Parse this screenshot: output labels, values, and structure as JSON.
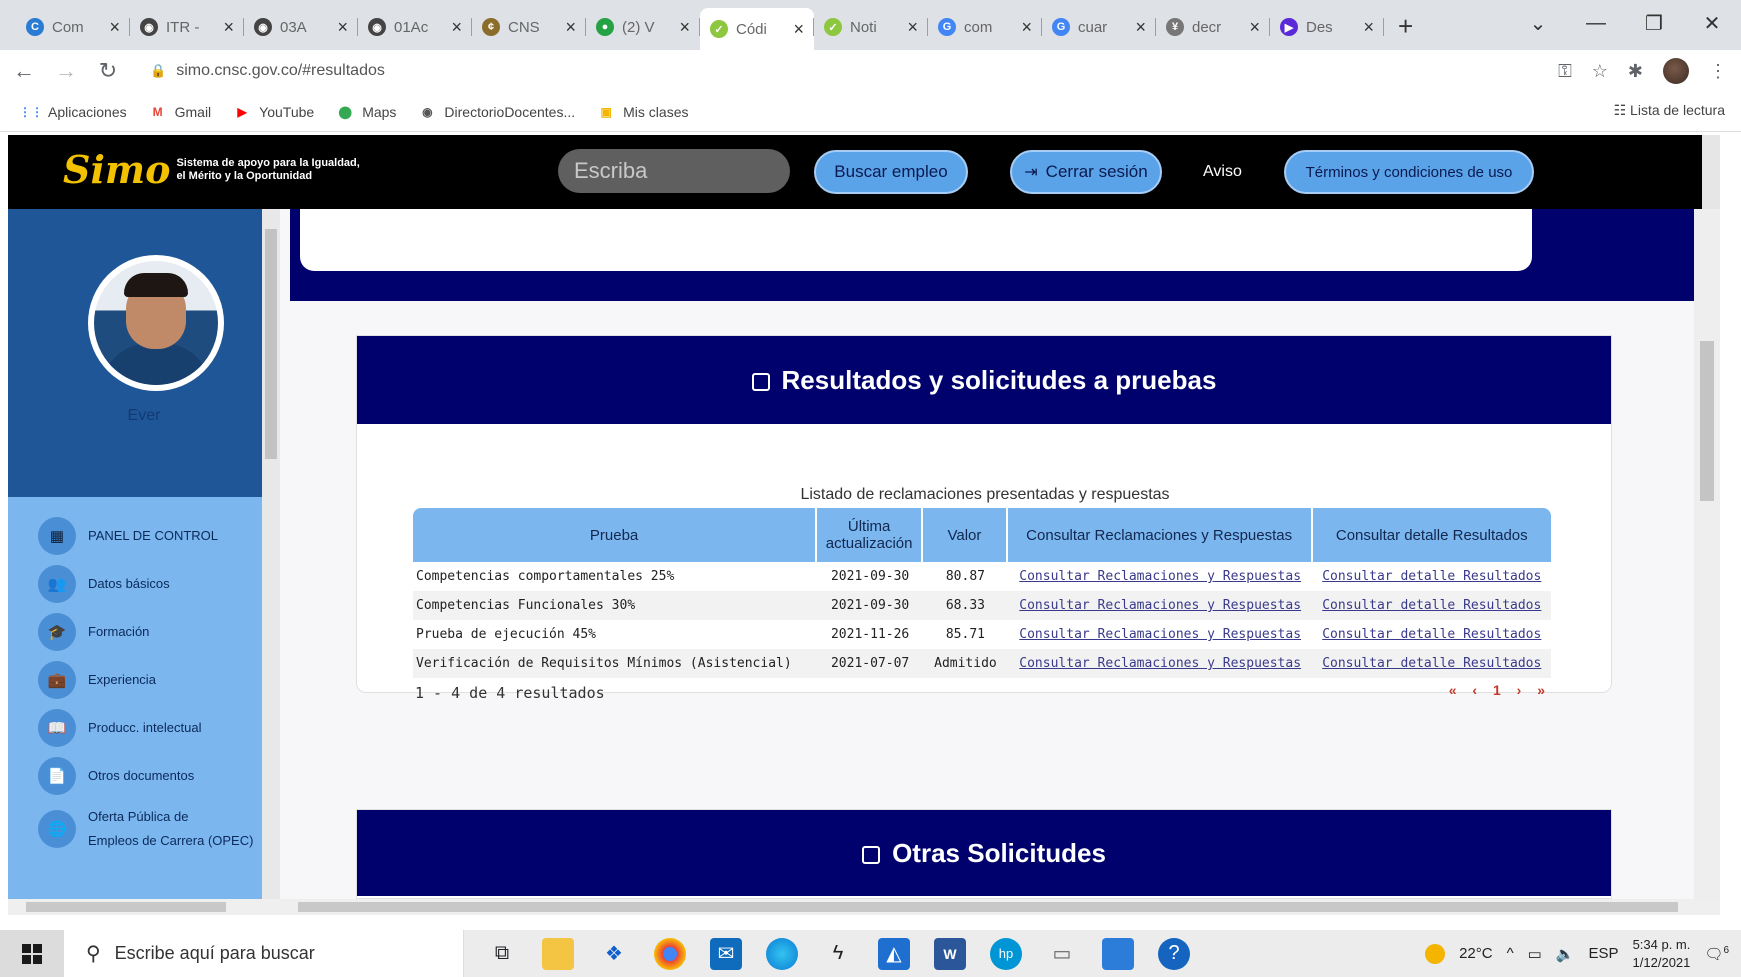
{
  "browser": {
    "tabs": [
      {
        "label": "Com",
        "color": "#2a7bd3",
        "glyph": "C"
      },
      {
        "label": "ITR -",
        "color": "#444",
        "glyph": "◉"
      },
      {
        "label": "03A",
        "color": "#444",
        "glyph": "◉"
      },
      {
        "label": "01Ac",
        "color": "#444",
        "glyph": "◉"
      },
      {
        "label": "CNS",
        "color": "#8a6d2b",
        "glyph": "¢"
      },
      {
        "label": "(2) V",
        "color": "#25a244",
        "glyph": "●"
      },
      {
        "label": "Códi",
        "color": "#8dc63f",
        "glyph": "✓"
      },
      {
        "label": "Noti",
        "color": "#8dc63f",
        "glyph": "✓"
      },
      {
        "label": "com",
        "color": "#4285f4",
        "glyph": "G"
      },
      {
        "label": "cuar",
        "color": "#4285f4",
        "glyph": "G"
      },
      {
        "label": "decr",
        "color": "#777",
        "glyph": "¥"
      },
      {
        "label": "Des",
        "color": "#5b2ad8",
        "glyph": "▶"
      }
    ],
    "active_tab_index": 6,
    "url": "simo.cnsc.gov.co/#resultados",
    "bookmarks": [
      {
        "label": "Aplicaciones",
        "icon": "apps-grid-icon"
      },
      {
        "label": "Gmail",
        "icon": "gmail-icon"
      },
      {
        "label": "YouTube",
        "icon": "youtube-icon"
      },
      {
        "label": "Maps",
        "icon": "maps-pin-icon"
      },
      {
        "label": "DirectorioDocentes...",
        "icon": "globe-icon"
      },
      {
        "label": "Mis clases",
        "icon": "classroom-icon"
      }
    ],
    "reading_list": "Lista de lectura"
  },
  "site": {
    "logo_text": "Simo",
    "logo_tagline_1": "Sistema de apoyo para la Igualdad,",
    "logo_tagline_2": "el Mérito y la Oportunidad",
    "search_placeholder": "Escriba",
    "search_button": "Buscar empleo",
    "logout_button": "Cerrar sesión",
    "notice_link": "Aviso",
    "terms_button": "Términos y condiciones de uso"
  },
  "sidebar": {
    "user_name": "Ever",
    "items": [
      {
        "label": "PANEL DE CONTROL",
        "icon": "dashboard-icon",
        "glyph": "▦"
      },
      {
        "label": "Datos básicos",
        "icon": "people-icon",
        "glyph": "👥"
      },
      {
        "label": "Formación",
        "icon": "graduation-icon",
        "glyph": "🎓"
      },
      {
        "label": "Experiencia",
        "icon": "briefcase-icon",
        "glyph": "💼"
      },
      {
        "label": "Producc. intelectual",
        "icon": "book-icon",
        "glyph": "📖"
      },
      {
        "label": "Otros documentos",
        "icon": "document-icon",
        "glyph": "📄"
      },
      {
        "label": "Oferta Pública de",
        "label2": "Empleos de Carrera (OPEC)",
        "icon": "globe-icon",
        "glyph": "🌐"
      }
    ]
  },
  "results": {
    "title": "Resultados y solicitudes a pruebas",
    "caption": "Listado de reclamaciones presentadas y respuestas",
    "columns": [
      "Prueba",
      "Última actualización",
      "Valor",
      "Consultar Reclamaciones y Respuestas",
      "Consultar detalle Resultados"
    ],
    "rows": [
      {
        "prueba": "Competencias comportamentales 25%",
        "fecha": "2021-09-30",
        "valor": "80.87",
        "link1": "Consultar Reclamaciones y Respuestas",
        "link2": "Consultar detalle Resultados"
      },
      {
        "prueba": "Competencias Funcionales 30%",
        "fecha": "2021-09-30",
        "valor": "68.33",
        "link1": "Consultar Reclamaciones y Respuestas",
        "link2": "Consultar detalle Resultados"
      },
      {
        "prueba": "Prueba de ejecución 45%",
        "fecha": "2021-11-26",
        "valor": "85.71",
        "link1": "Consultar Reclamaciones y Respuestas",
        "link2": "Consultar detalle Resultados"
      },
      {
        "prueba": "Verificación de Requisitos Mínimos (Asistencial)",
        "fecha": "2021-07-07",
        "valor": "Admitido",
        "link1": "Consultar Reclamaciones y Respuestas",
        "link2": "Consultar detalle Resultados"
      }
    ],
    "footer": "1 - 4 de 4 resultados",
    "pager": {
      "first": "«",
      "prev": "‹",
      "current": "1",
      "next": "›",
      "last": "»"
    }
  },
  "other": {
    "title": "Otras Solicitudes"
  },
  "taskbar": {
    "search_placeholder": "Escribe aquí para buscar",
    "temperature": "22°C",
    "language": "ESP",
    "time": "5:34 p. m.",
    "date": "1/12/2021",
    "notification_count": "6"
  }
}
